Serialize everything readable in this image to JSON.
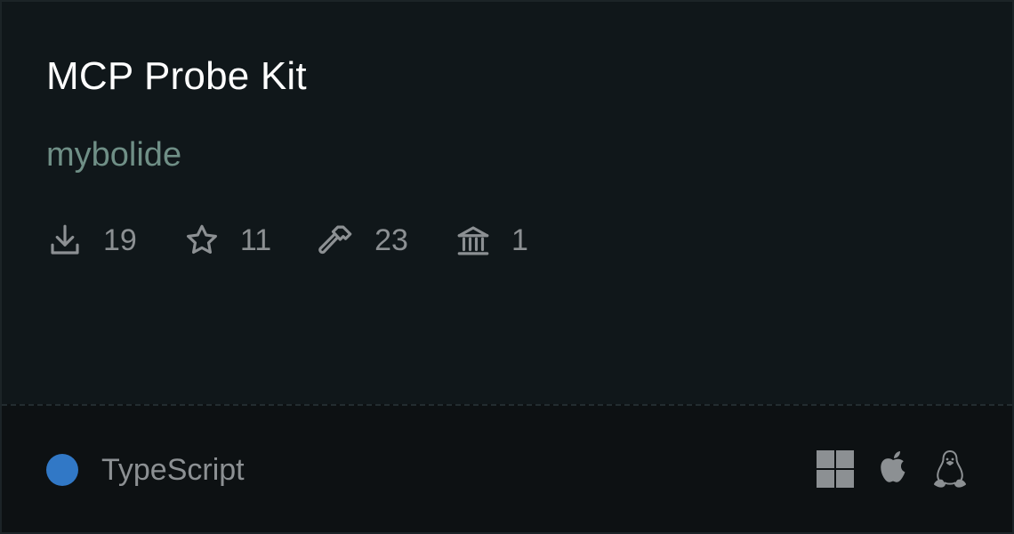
{
  "server": {
    "name": "MCP Probe Kit",
    "author": "mybolide"
  },
  "stats": [
    {
      "icon": "download-icon",
      "value": "19"
    },
    {
      "icon": "star-icon",
      "value": "11"
    },
    {
      "icon": "hammer-icon",
      "value": "23"
    },
    {
      "icon": "bank-icon",
      "value": "1"
    }
  ],
  "language": {
    "name": "TypeScript",
    "color": "#3178c6"
  },
  "platforms": [
    "windows-icon",
    "apple-icon",
    "linux-icon"
  ]
}
